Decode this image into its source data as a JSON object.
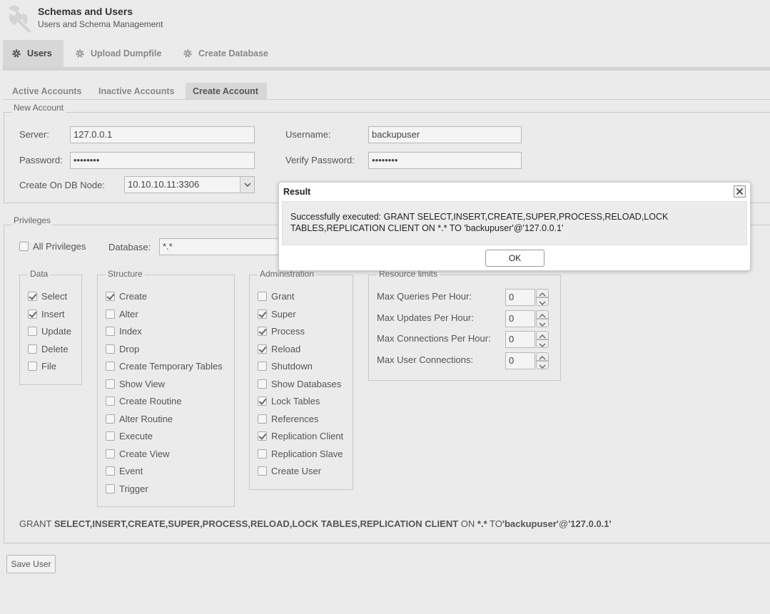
{
  "header": {
    "title": "Schemas and Users",
    "subtitle": "Users and Schema Management",
    "logo_icon": "wrench-icon"
  },
  "top_tabs": [
    {
      "label": "Users",
      "icon": "gear-icon",
      "active": true
    },
    {
      "label": "Upload Dumpfile",
      "icon": "gear-icon",
      "active": false
    },
    {
      "label": "Create Database",
      "icon": "gear-icon",
      "active": false
    }
  ],
  "sub_tabs": [
    {
      "label": "Active Accounts",
      "active": false
    },
    {
      "label": "Inactive Accounts",
      "active": false
    },
    {
      "label": "Create Account",
      "active": true
    }
  ],
  "new_account": {
    "legend": "New Account",
    "server_label": "Server:",
    "server_value": "127.0.0.1",
    "username_label": "Username:",
    "username_value": "backupuser",
    "password_label": "Password:",
    "password_value": "••••••••",
    "verify_label": "Verify Password:",
    "verify_value": "••••••••",
    "node_label": "Create On DB Node:",
    "node_value": "10.10.10.11:3306"
  },
  "privileges": {
    "legend": "Privileges",
    "all_label": "All Privileges",
    "all_checked": false,
    "database_label": "Database:",
    "database_value": "*.*",
    "data": {
      "legend": "Data",
      "items": [
        {
          "label": "Select",
          "checked": true
        },
        {
          "label": "Insert",
          "checked": true
        },
        {
          "label": "Update",
          "checked": false
        },
        {
          "label": "Delete",
          "checked": false
        },
        {
          "label": "File",
          "checked": false
        }
      ]
    },
    "structure": {
      "legend": "Structure",
      "items": [
        {
          "label": "Create",
          "checked": true
        },
        {
          "label": "Alter",
          "checked": false
        },
        {
          "label": "Index",
          "checked": false
        },
        {
          "label": "Drop",
          "checked": false
        },
        {
          "label": "Create Temporary Tables",
          "checked": false
        },
        {
          "label": "Show View",
          "checked": false
        },
        {
          "label": "Create Routine",
          "checked": false
        },
        {
          "label": "Alter Routine",
          "checked": false
        },
        {
          "label": "Execute",
          "checked": false
        },
        {
          "label": "Create View",
          "checked": false
        },
        {
          "label": "Event",
          "checked": false
        },
        {
          "label": "Trigger",
          "checked": false
        }
      ]
    },
    "administration": {
      "legend": "Administration",
      "items": [
        {
          "label": "Grant",
          "checked": false
        },
        {
          "label": "Super",
          "checked": true
        },
        {
          "label": "Process",
          "checked": true
        },
        {
          "label": "Reload",
          "checked": true
        },
        {
          "label": "Shutdown",
          "checked": false
        },
        {
          "label": "Show Databases",
          "checked": false
        },
        {
          "label": "Lock Tables",
          "checked": true
        },
        {
          "label": "References",
          "checked": false
        },
        {
          "label": "Replication Client",
          "checked": true
        },
        {
          "label": "Replication Slave",
          "checked": false
        },
        {
          "label": "Create User",
          "checked": false
        }
      ]
    },
    "resource_limits": {
      "legend": "Resource limits",
      "items": [
        {
          "label": "Max Queries Per Hour:",
          "value": "0"
        },
        {
          "label": "Max Updates Per Hour:",
          "value": "0"
        },
        {
          "label": "Max Connections Per Hour:",
          "value": "0"
        },
        {
          "label": "Max User Connections:",
          "value": "0"
        }
      ]
    },
    "grant_statement": {
      "kw_grant": "GRANT",
      "privs": "SELECT,INSERT,CREATE,SUPER,PROCESS,RELOAD,LOCK TABLES,REPLICATION CLIENT",
      "kw_on": "ON",
      "db": "*.*",
      "kw_to": "TO",
      "user_q": "'backupuser'",
      "at": "@",
      "host_q": "'127.0.0.1'"
    }
  },
  "save_button": "Save User",
  "dialog": {
    "title": "Result",
    "message": "Successfully executed: GRANT SELECT,INSERT,CREATE,SUPER,PROCESS,RELOAD,LOCK TABLES,REPLICATION CLIENT ON *.* TO 'backupuser'@'127.0.0.1'",
    "ok_label": "OK",
    "close_icon": "close-icon"
  }
}
